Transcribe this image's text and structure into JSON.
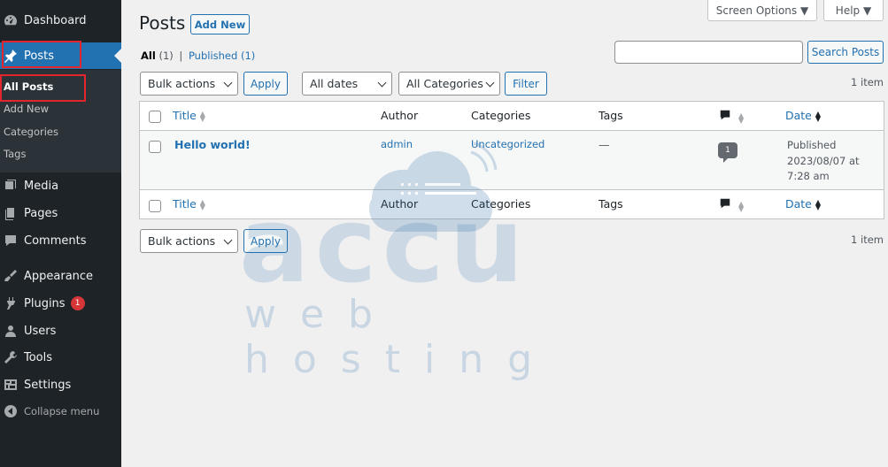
{
  "sidebar": {
    "items": [
      {
        "label": "Dashboard",
        "icon": "dashboard-icon"
      },
      {
        "label": "Posts",
        "icon": "pin-icon"
      },
      {
        "label": "Media",
        "icon": "media-icon"
      },
      {
        "label": "Pages",
        "icon": "pages-icon"
      },
      {
        "label": "Comments",
        "icon": "comments-icon"
      },
      {
        "label": "Appearance",
        "icon": "appearance-icon"
      },
      {
        "label": "Plugins",
        "icon": "plugins-icon",
        "badge": "1"
      },
      {
        "label": "Users",
        "icon": "users-icon"
      },
      {
        "label": "Tools",
        "icon": "tools-icon"
      },
      {
        "label": "Settings",
        "icon": "settings-icon"
      }
    ],
    "submenu": [
      "All Posts",
      "Add New",
      "Categories",
      "Tags"
    ],
    "collapse_label": "Collapse menu"
  },
  "header": {
    "title": "Posts",
    "add_new": "Add New",
    "screen_options": "Screen Options ▼",
    "help": "Help ▼"
  },
  "filters": {
    "all_label": "All",
    "all_count": "(1)",
    "separator": "|",
    "published_label": "Published",
    "published_count": "(1)",
    "search_button": "Search Posts",
    "search_value": "",
    "bulk_actions": "Bulk actions",
    "apply": "Apply",
    "all_dates": "All dates",
    "all_categories": "All Categories",
    "filter": "Filter",
    "item_count": "1 item"
  },
  "table": {
    "columns": {
      "title": "Title",
      "author": "Author",
      "categories": "Categories",
      "tags": "Tags",
      "date": "Date"
    },
    "rows": [
      {
        "title": "Hello world!",
        "author": "admin",
        "categories": "Uncategorized",
        "tags": "—",
        "comments": "1",
        "date_status": "Published",
        "date_value": "2023/08/07 at",
        "date_time": "7:28 am"
      }
    ]
  },
  "watermark": {
    "brand": "accu",
    "tagline": "web hosting"
  },
  "colors": {
    "sidebar_bg": "#1d2327",
    "accent": "#2271b1",
    "highlight_box": "#e3262e",
    "badge": "#d63638"
  }
}
